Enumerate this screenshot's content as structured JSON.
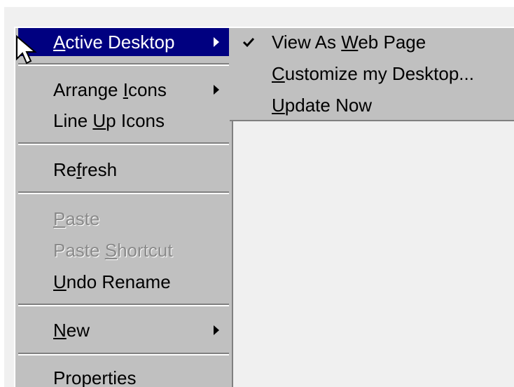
{
  "context_menu": {
    "active_desktop": {
      "before": "",
      "access": "A",
      "after": "ctive Desktop"
    },
    "arrange_icons": {
      "before": "Arrange ",
      "access": "I",
      "after": "cons"
    },
    "line_up_icons": {
      "before": "Line ",
      "access": "U",
      "after": "p Icons"
    },
    "refresh": {
      "before": "Re",
      "access": "f",
      "after": "resh"
    },
    "paste": {
      "before": "",
      "access": "P",
      "after": "aste"
    },
    "paste_shortcut": {
      "before": "Paste ",
      "access": "S",
      "after": "hortcut"
    },
    "undo_rename": {
      "before": "",
      "access": "U",
      "after": "ndo Rename"
    },
    "new": {
      "before": "",
      "access": "N",
      "after": "ew"
    },
    "properties": {
      "before": "P",
      "access": "r",
      "after": "operties"
    }
  },
  "active_desktop_submenu": {
    "view_as_web_page": {
      "before": "View As ",
      "access": "W",
      "after": "eb Page",
      "checked": true
    },
    "customize": {
      "before": "",
      "access": "C",
      "after": "ustomize my Desktop..."
    },
    "update_now": {
      "before": "",
      "access": "U",
      "after": "pdate Now"
    }
  },
  "colors": {
    "menu_face": "#c0c0c0",
    "highlight": "#000080",
    "highlight_text": "#ffffff",
    "disabled_text": "#8a8a8a",
    "desktop": "#f0f0f0"
  },
  "icons": {
    "cursor": "mouse-pointer-icon",
    "check": "check-icon",
    "submenu_arrow": "submenu-arrow-icon"
  }
}
